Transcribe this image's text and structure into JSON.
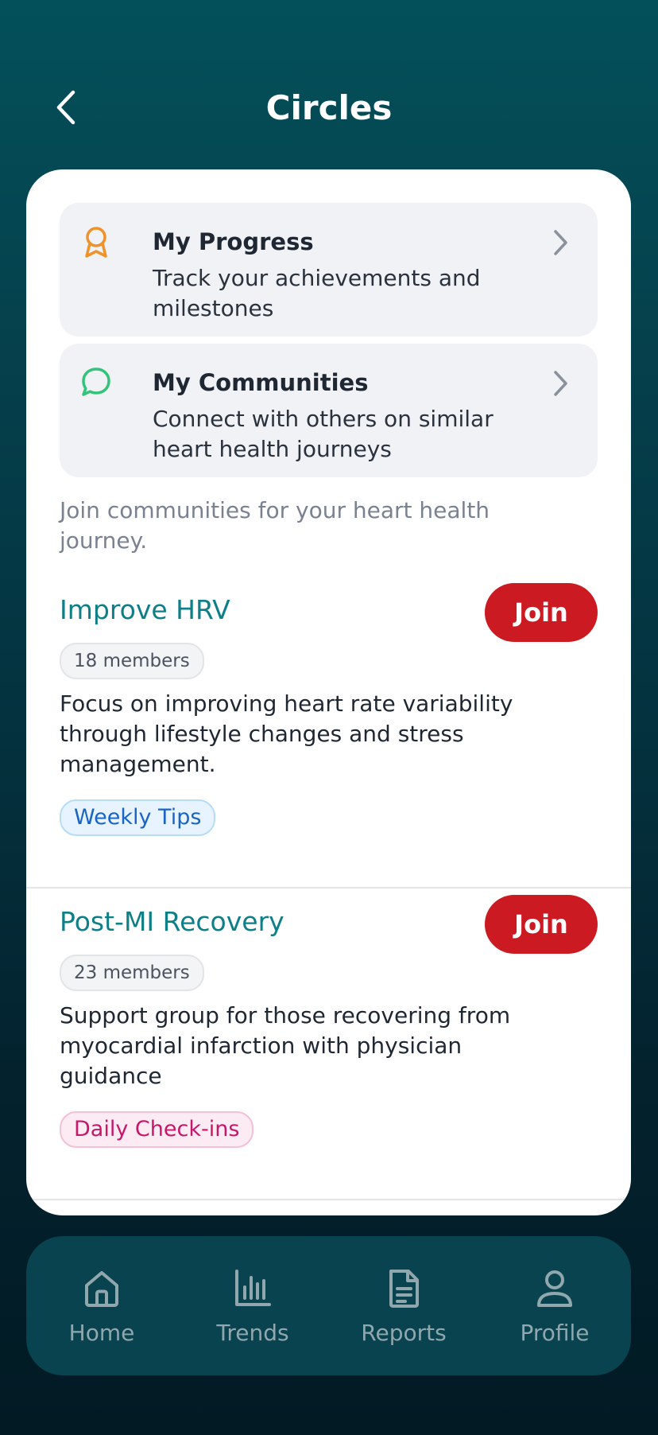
{
  "header": {
    "title": "Circles"
  },
  "quick_links": [
    {
      "title": "My Progress",
      "subtitle": "Track your achievements and milestones",
      "icon": "award-ribbon-icon",
      "icon_color": "#f0922b"
    },
    {
      "title": "My Communities",
      "subtitle": "Connect with others on similar heart health journeys",
      "icon": "chat-bubble-icon",
      "icon_color": "#34c37a"
    }
  ],
  "intro": "Join communities for your heart health journey.",
  "communities": [
    {
      "name": "Improve HRV",
      "members": "18 members",
      "description": "Focus on improving heart rate variability through lifestyle changes and stress management.",
      "tag": "Weekly Tips",
      "join_label": "Join"
    },
    {
      "name": "Post-MI Recovery",
      "members": "23 members",
      "description": "Support group for those recovering from myocardial infarction with physician guidance",
      "tag": "Daily Check-ins",
      "join_label": "Join"
    }
  ],
  "bottom_nav": [
    {
      "label": "Home",
      "icon": "home-icon"
    },
    {
      "label": "Trends",
      "icon": "bar-chart-icon"
    },
    {
      "label": "Reports",
      "icon": "document-icon"
    },
    {
      "label": "Profile",
      "icon": "user-icon"
    }
  ],
  "colors": {
    "accent_teal": "#0e7f86",
    "join_red": "#cc1a22",
    "nav_icon": "#8fa7ad"
  }
}
